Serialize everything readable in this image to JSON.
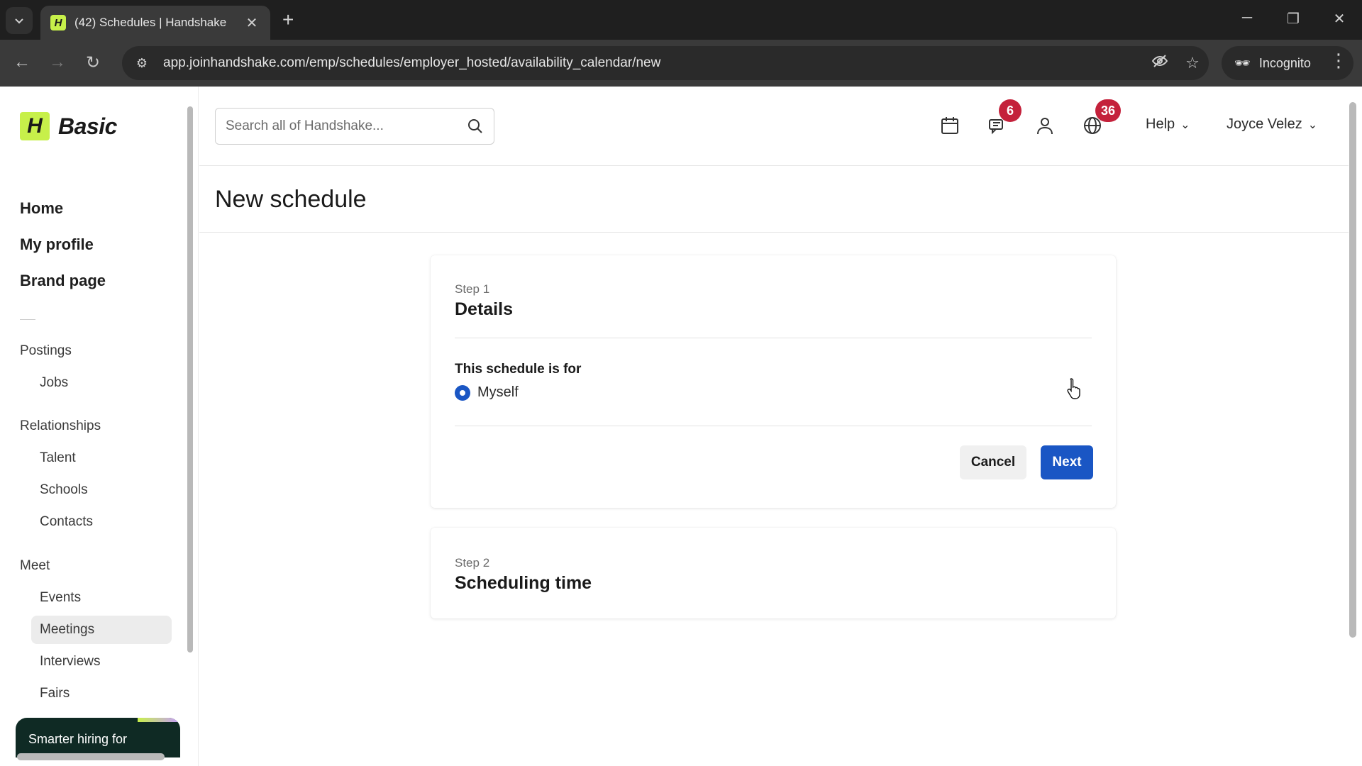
{
  "browser": {
    "tab_title": "(42) Schedules | Handshake",
    "favicon_letter": "H",
    "url": "app.joinhandshake.com/emp/schedules/employer_hosted/availability_calendar/new",
    "incognito_label": "Incognito"
  },
  "sidebar": {
    "logo_letter": "H",
    "plan": "Basic",
    "primary": [
      "Home",
      "My profile",
      "Brand page"
    ],
    "sections": {
      "postings": {
        "heading": "Postings",
        "items": [
          "Jobs"
        ]
      },
      "relationships": {
        "heading": "Relationships",
        "items": [
          "Talent",
          "Schools",
          "Contacts"
        ]
      },
      "meet": {
        "heading": "Meet",
        "items": [
          "Events",
          "Meetings",
          "Interviews",
          "Fairs"
        ],
        "active": "Meetings"
      }
    },
    "promo_text": "Smarter hiring for"
  },
  "topbar": {
    "search_placeholder": "Search all of Handshake...",
    "messages_badge": "6",
    "notifications_badge": "36",
    "help_label": "Help",
    "user_name": "Joyce Velez"
  },
  "page": {
    "title": "New schedule",
    "step1": {
      "label": "Step 1",
      "title": "Details",
      "field_label": "This schedule is for",
      "option_selected": "Myself",
      "cancel_label": "Cancel",
      "next_label": "Next"
    },
    "step2": {
      "label": "Step 2",
      "title": "Scheduling time"
    }
  },
  "colors": {
    "brand_lime": "#c7f04a",
    "primary_blue": "#1a56c4",
    "badge_red": "#c4213b"
  }
}
